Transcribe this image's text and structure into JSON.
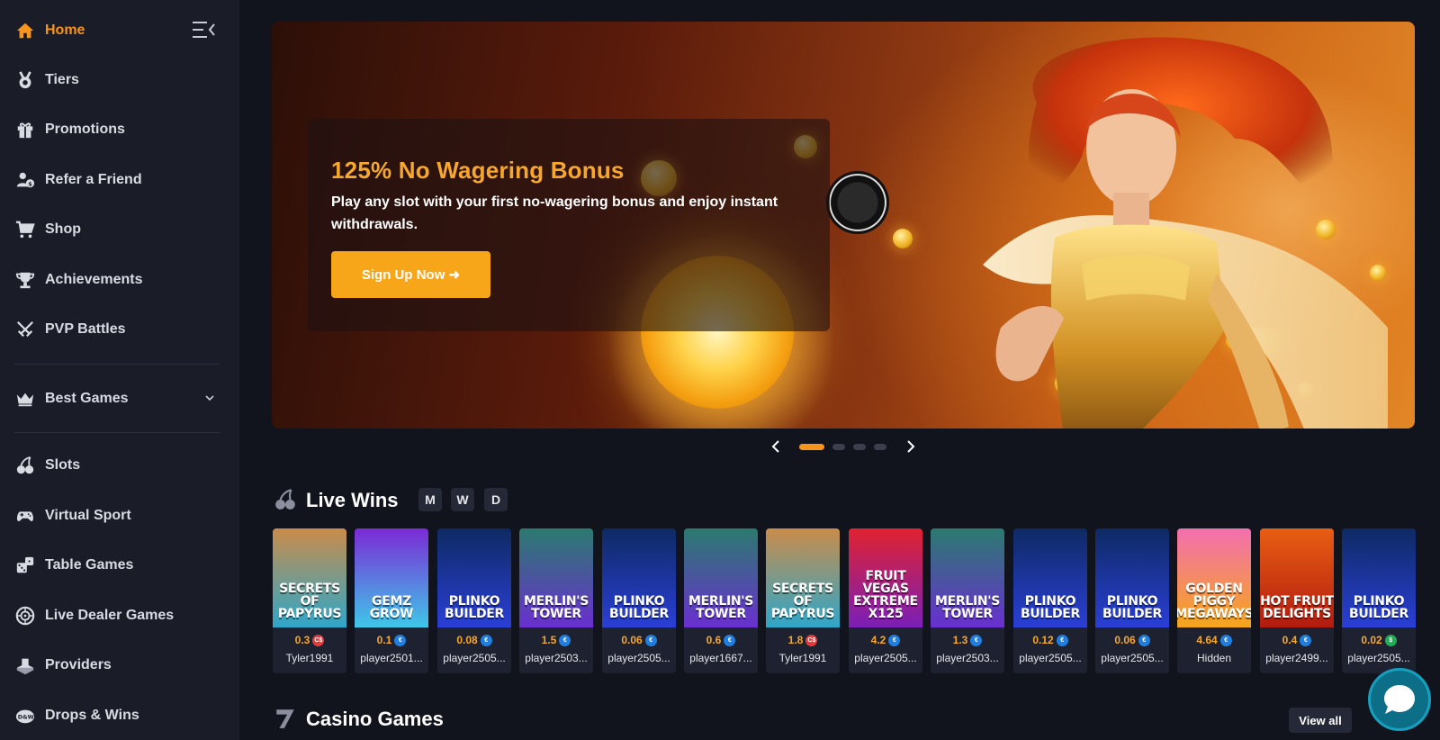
{
  "sidebar": {
    "collapse_icon": "collapse-menu-icon",
    "items": [
      {
        "label": "Home",
        "icon": "home-icon",
        "active": true
      },
      {
        "label": "Tiers",
        "icon": "medal-icon"
      },
      {
        "label": "Promotions",
        "icon": "gift-icon"
      },
      {
        "label": "Refer a Friend",
        "icon": "refer-icon"
      },
      {
        "label": "Shop",
        "icon": "cart-icon"
      },
      {
        "label": "Achievements",
        "icon": "trophy-icon"
      },
      {
        "label": "PVP Battles",
        "icon": "swords-icon"
      },
      {
        "label": "Best Games",
        "icon": "crown-icon"
      },
      {
        "label": "Slots",
        "icon": "cherries-icon"
      },
      {
        "label": "Virtual Sport",
        "icon": "gamepad-icon"
      },
      {
        "label": "Table Games",
        "icon": "dice-icon"
      },
      {
        "label": "Live Dealer Games",
        "icon": "roulette-icon"
      },
      {
        "label": "Providers",
        "icon": "providers-icon"
      },
      {
        "label": "Drops & Wins",
        "icon": "drops-icon"
      }
    ]
  },
  "banner": {
    "title": "125% No Wagering Bonus",
    "text": "Play any slot with your first no-wagering bonus and enjoy instant withdrawals.",
    "button": "Sign Up Now ➜",
    "active_slide": 1,
    "slide_count": 4
  },
  "live_wins": {
    "title": "Live Wins",
    "periods": [
      "M",
      "W",
      "D"
    ],
    "wins": [
      {
        "game": "SECRETS OF PAPYRUS",
        "amount": "0.3",
        "currency": "C$",
        "user": "Tyler1991"
      },
      {
        "game": "GEMZ GROW",
        "amount": "0.1",
        "currency": "€",
        "user": "player2501..."
      },
      {
        "game": "PLINKO BUILDER",
        "amount": "0.08",
        "currency": "€",
        "user": "player2505..."
      },
      {
        "game": "MERLIN'S TOWER",
        "amount": "1.5",
        "currency": "€",
        "user": "player2503..."
      },
      {
        "game": "PLINKO BUILDER",
        "amount": "0.06",
        "currency": "€",
        "user": "player2505..."
      },
      {
        "game": "MERLIN'S TOWER",
        "amount": "0.6",
        "currency": "€",
        "user": "player1667..."
      },
      {
        "game": "SECRETS OF PAPYRUS",
        "amount": "1.8",
        "currency": "C$",
        "user": "Tyler1991"
      },
      {
        "game": "FRUIT VEGAS EXTREME X125",
        "amount": "4.2",
        "currency": "€",
        "user": "player2505..."
      },
      {
        "game": "MERLIN'S TOWER",
        "amount": "1.3",
        "currency": "€",
        "user": "player2503..."
      },
      {
        "game": "PLINKO BUILDER",
        "amount": "0.12",
        "currency": "€",
        "user": "player2505..."
      },
      {
        "game": "PLINKO BUILDER",
        "amount": "0.06",
        "currency": "€",
        "user": "player2505..."
      },
      {
        "game": "GOLDEN PIGGY MEGAWAYS",
        "amount": "4.64",
        "currency": "€",
        "user": "Hidden"
      },
      {
        "game": "HOT FRUIT DELIGHTS",
        "amount": "0.4",
        "currency": "€",
        "user": "player2499..."
      },
      {
        "game": "PLINKO BUILDER",
        "amount": "0.02",
        "currency": "$",
        "user": "player2505..."
      }
    ]
  },
  "casino_games": {
    "title": "Casino Games",
    "view_all": "View all"
  },
  "colors": {
    "accent": "#f7941d",
    "sidebar_bg": "#1a1c27",
    "page_bg": "#12141d"
  }
}
